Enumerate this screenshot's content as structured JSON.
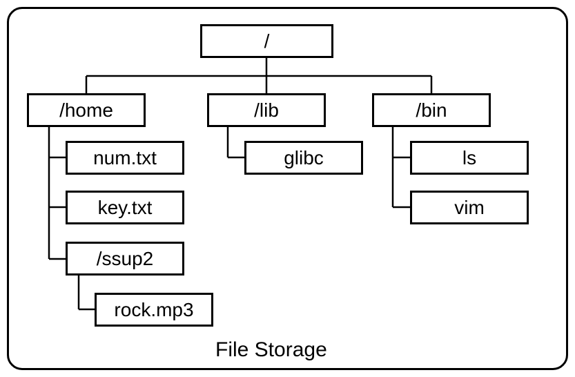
{
  "title": "File Storage",
  "tree": {
    "root": {
      "label": "/",
      "children": [
        {
          "label": "/home",
          "children": [
            {
              "label": "num.txt"
            },
            {
              "label": "key.txt"
            },
            {
              "label": "/ssup2",
              "children": [
                {
                  "label": "rock.mp3"
                }
              ]
            }
          ]
        },
        {
          "label": "/lib",
          "children": [
            {
              "label": "glibc"
            }
          ]
        },
        {
          "label": "/bin",
          "children": [
            {
              "label": "ls"
            },
            {
              "label": "vim"
            }
          ]
        }
      ]
    }
  }
}
